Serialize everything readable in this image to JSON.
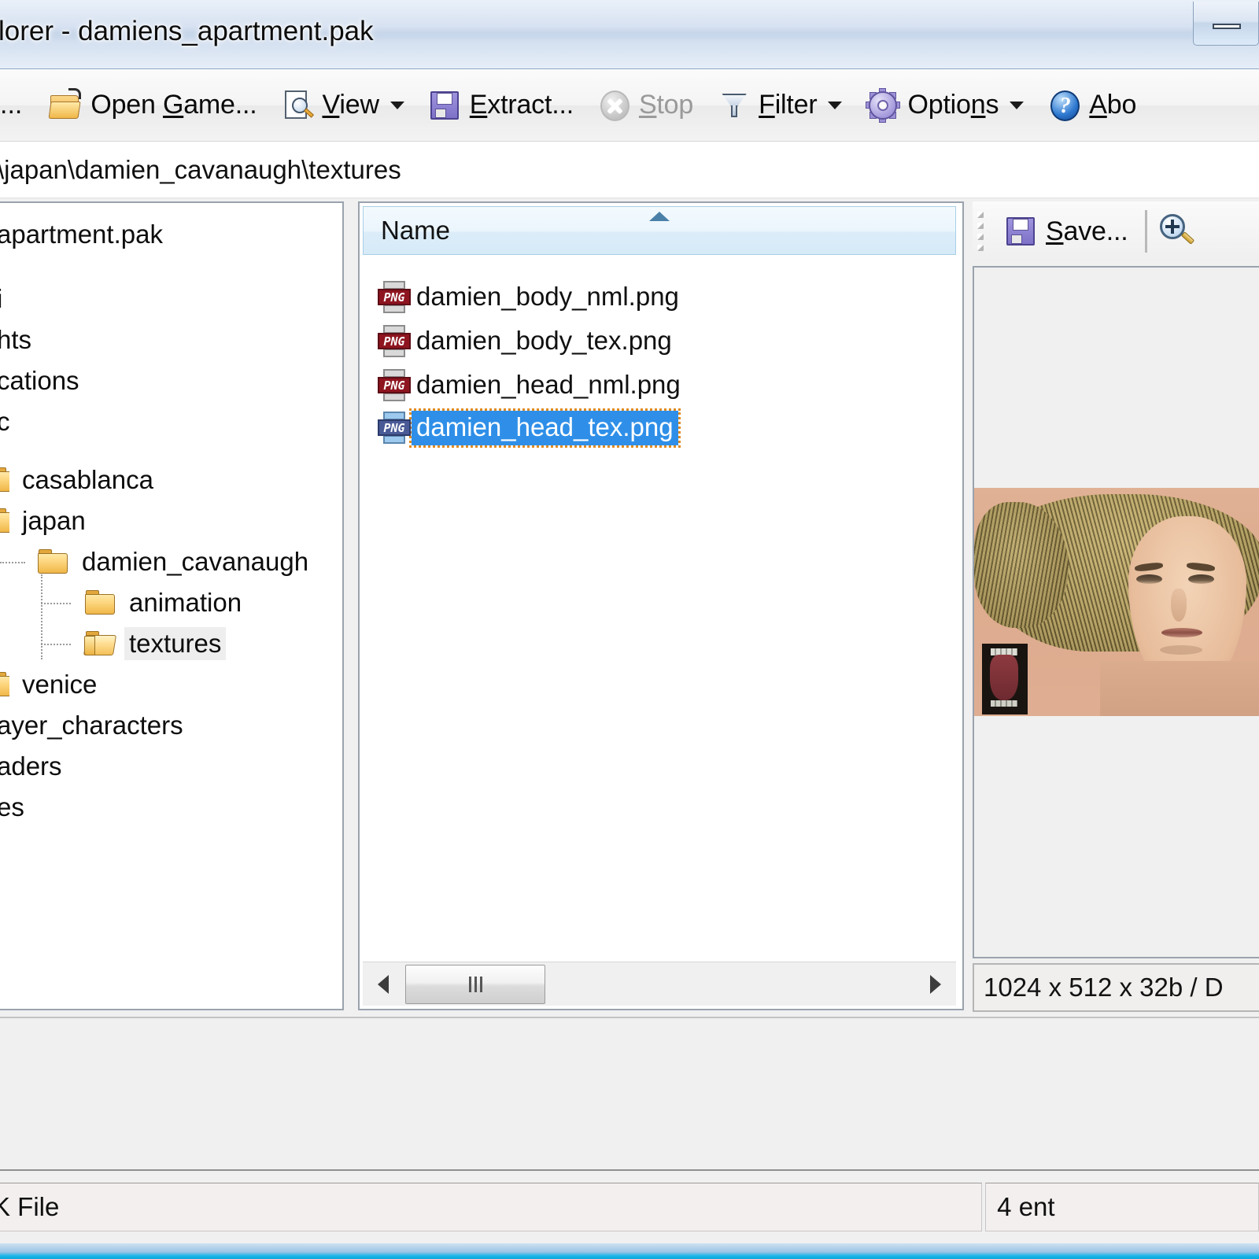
{
  "window": {
    "title": "lorer - damiens_apartment.pak",
    "minimize_label": "Minimize"
  },
  "toolbar": {
    "items": [
      {
        "label": "...",
        "icon": "ellipsis-icon",
        "disabled": false,
        "dropdown": false
      },
      {
        "label": "Open Game...",
        "accel": "G",
        "icon": "folder-open-icon",
        "disabled": false,
        "dropdown": false
      },
      {
        "label": "View",
        "accel": "V",
        "icon": "view-icon",
        "disabled": false,
        "dropdown": true
      },
      {
        "label": "Extract...",
        "accel": "E",
        "icon": "floppy-icon",
        "disabled": false,
        "dropdown": false
      },
      {
        "label": "Stop",
        "accel": "S",
        "icon": "stop-icon",
        "disabled": true,
        "dropdown": false
      },
      {
        "label": "Filter",
        "accel": "F",
        "icon": "filter-icon",
        "disabled": false,
        "dropdown": true
      },
      {
        "label": "Options",
        "accel": "n",
        "icon": "gear-icon",
        "disabled": false,
        "dropdown": true
      },
      {
        "label": "Abo",
        "accel": "A",
        "icon": "help-icon",
        "disabled": false,
        "dropdown": false
      }
    ]
  },
  "path": {
    "value": "\\japan\\damien_cavanaugh\\textures"
  },
  "tree": {
    "items": [
      {
        "label": "apartment.pak",
        "indent": 0,
        "icon": "none",
        "selected": false
      },
      {
        "label": "i",
        "indent": 0,
        "icon": "none",
        "selected": false
      },
      {
        "label": "hts",
        "indent": 0,
        "icon": "none",
        "selected": false
      },
      {
        "label": "cations",
        "indent": 0,
        "icon": "none",
        "selected": false
      },
      {
        "label": "c",
        "indent": 0,
        "icon": "none",
        "selected": false
      },
      {
        "label": "casablanca",
        "indent": 0,
        "icon": "folder-closed-icon",
        "selected": false
      },
      {
        "label": "japan",
        "indent": 0,
        "icon": "folder-closed-icon",
        "selected": false
      },
      {
        "label": "damien_cavanaugh",
        "indent": 1,
        "icon": "folder-closed-icon",
        "selected": false
      },
      {
        "label": "animation",
        "indent": 2,
        "icon": "folder-closed-icon",
        "selected": false
      },
      {
        "label": "textures",
        "indent": 2,
        "icon": "folder-open-icon",
        "selected": true
      },
      {
        "label": "venice",
        "indent": 0,
        "icon": "folder-closed-icon",
        "selected": false
      },
      {
        "label": "ayer_characters",
        "indent": 0,
        "icon": "none",
        "selected": false
      },
      {
        "label": "aders",
        "indent": 0,
        "icon": "none",
        "selected": false
      },
      {
        "label": "es",
        "indent": 0,
        "icon": "none",
        "selected": false
      }
    ]
  },
  "filelist": {
    "column_header": "Name",
    "sort_direction": "ascending",
    "rows": [
      {
        "name": "damien_body_nml.png",
        "icon": "png-file-icon",
        "selected": false
      },
      {
        "name": "damien_body_tex.png",
        "icon": "png-file-icon",
        "selected": false
      },
      {
        "name": "damien_head_nml.png",
        "icon": "png-file-icon",
        "selected": false
      },
      {
        "name": "damien_head_tex.png",
        "icon": "png-file-icon",
        "selected": true
      }
    ],
    "scrollbar": {
      "left_arrow": "scroll-left-arrow-icon",
      "right_arrow": "scroll-right-arrow-icon"
    }
  },
  "preview": {
    "toolbar": {
      "gripper": "drag-gripper-icon",
      "save_label": "Save...",
      "save_accel": "S",
      "zoom_in": "zoom-in-icon"
    },
    "image_alt": "damien_head_tex texture preview",
    "status": "1024 x 512 x 32b / D"
  },
  "statusbar": {
    "left": "K File",
    "right": "4 ent"
  },
  "colors": {
    "selection_blue": "#2f8fe8",
    "focus_orange": "#e08a1e",
    "tree_selection_gray": "#eeeeee",
    "header_blue": "#d6eaf8",
    "titlebar_blue": "#c3d3e8",
    "taskbar_cyan": "#19b6e8"
  }
}
